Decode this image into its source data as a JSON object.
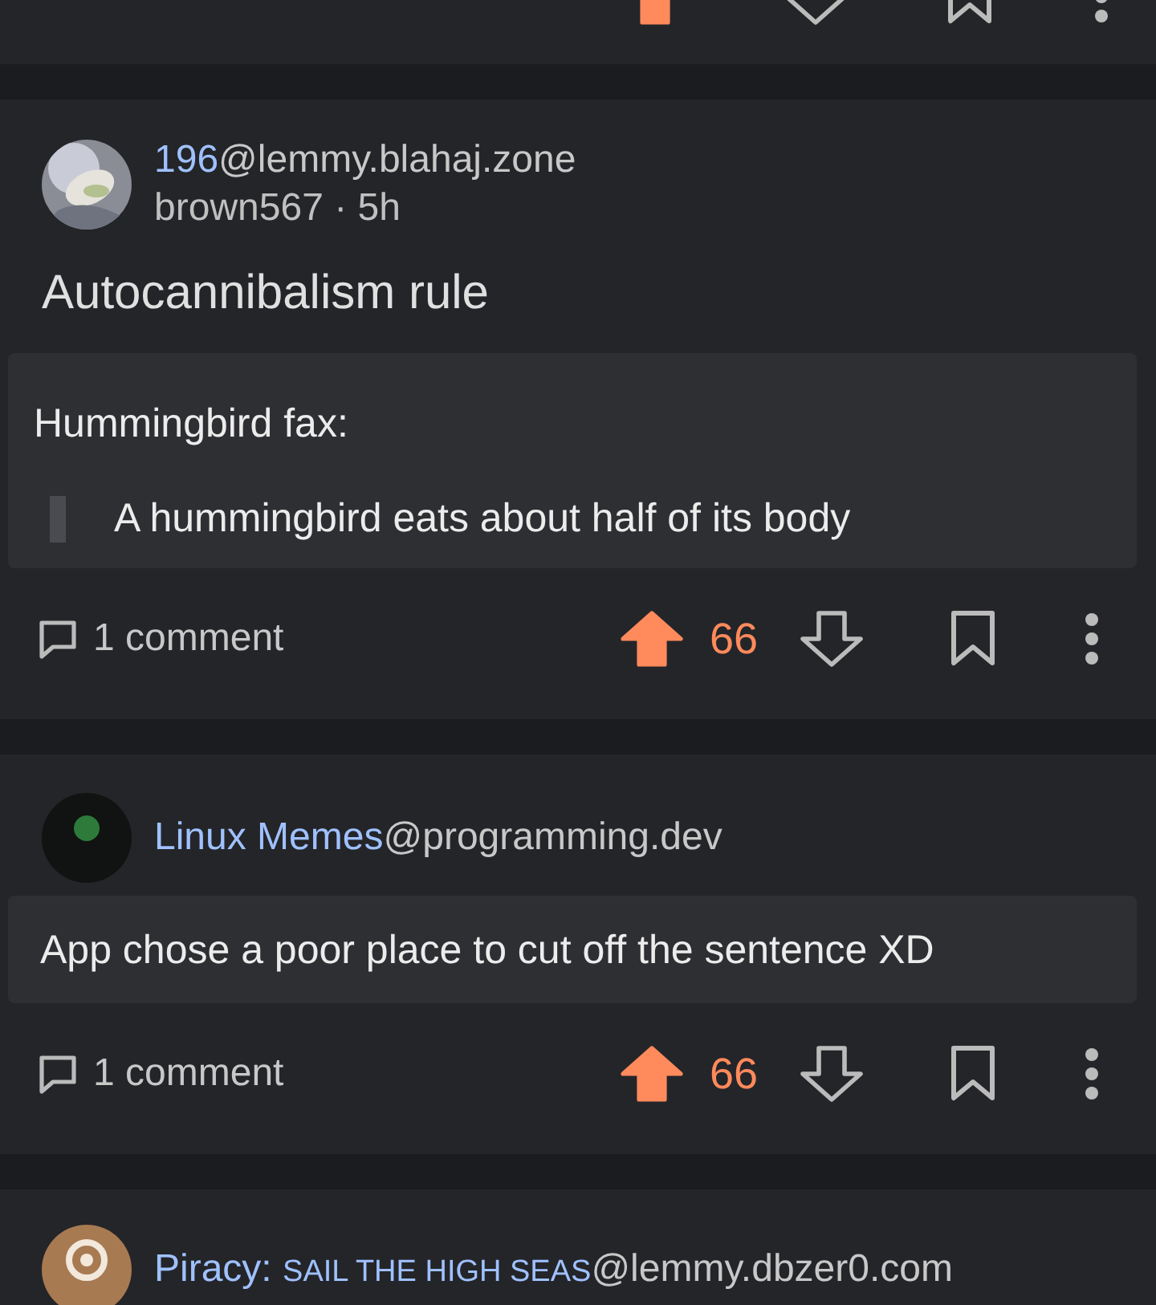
{
  "previous_post": {
    "upvoted": true,
    "saved": false
  },
  "posts": [
    {
      "avatar": {
        "kind": "picture"
      },
      "community": "196",
      "instance": "@lemmy.blahaj.zone",
      "byline": "brown567 · 5h",
      "title": "Autocannibalism rule",
      "body": [
        {
          "kind": "paragraph",
          "text": "Hummingbird fax:"
        },
        {
          "kind": "quote",
          "text": "A hummingbird eats about half of its body"
        }
      ],
      "comments": "1 comment",
      "score": "66",
      "upvoted": true,
      "saved": false
    },
    {
      "avatar": {
        "kind": "dark"
      },
      "community": "Linux Memes",
      "instance": "@programming.dev",
      "body": [
        {
          "kind": "paragraph",
          "text": "App chose a poor place to cut off the sentence XD"
        }
      ],
      "comments": "1 comment",
      "score": "66",
      "upvoted": true,
      "saved": false
    },
    {
      "avatar": {
        "kind": "ring"
      },
      "community": "Piracy: ",
      "community_caps": "SAIL THE HIGH SEAS",
      "instance": "@lemmy.dbzer0.com"
    }
  ]
}
